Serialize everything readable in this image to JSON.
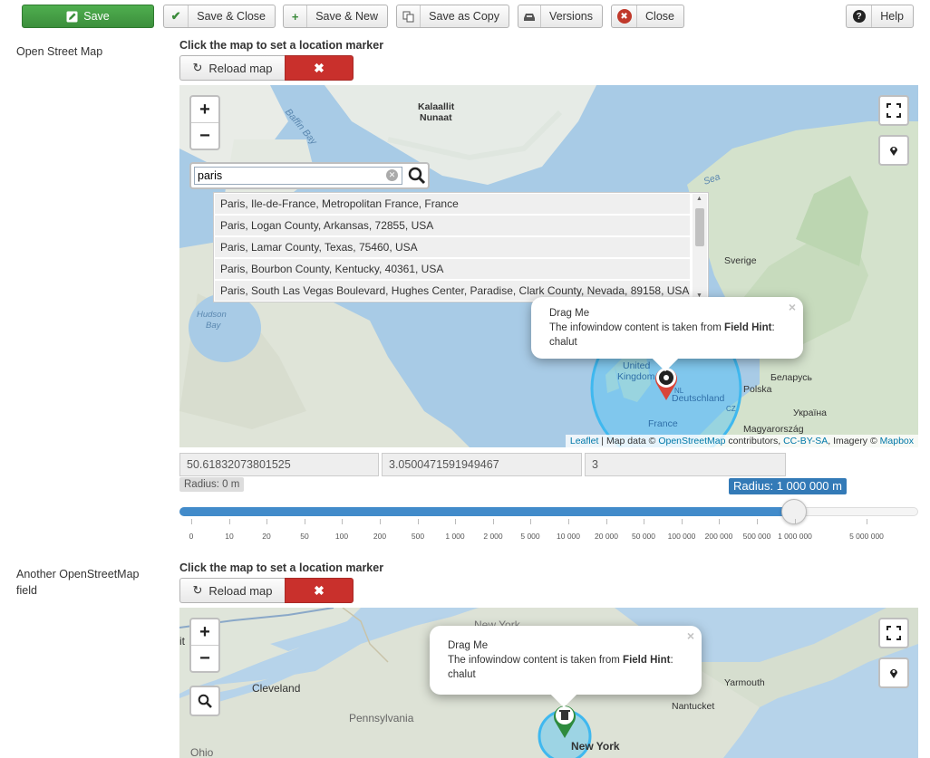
{
  "toolbar": {
    "save": "Save",
    "save_close": "Save & Close",
    "save_new": "Save & New",
    "save_copy": "Save as Copy",
    "versions": "Versions",
    "close": "Close",
    "help": "Help"
  },
  "field1": {
    "label": "Open Street Map",
    "instruction": "Click the map to set a location marker",
    "reload": "Reload map",
    "search_value": "paris",
    "results": [
      "Paris, Ile-de-France, Metropolitan France, France",
      "Paris, Logan County, Arkansas, 72855, USA",
      "Paris, Lamar County, Texas, 75460, USA",
      "Paris, Bourbon County, Kentucky, 40361, USA",
      "Paris, South Las Vegas Boulevard, Hughes Center, Paradise, Clark County, Nevada, 89158, USA"
    ],
    "popup": {
      "title": "Drag Me",
      "line_prefix": "The infowindow content is taken from ",
      "line_bold": "Field Hint",
      "line_suffix": ":",
      "value": "chalut"
    },
    "map_labels": {
      "kalaallit1": "Kalaallit",
      "kalaallit2": "Nunaat",
      "baffin": "Baffin Bay",
      "hudson1": "Hudson",
      "hudson2": "Bay",
      "sea": "Sea",
      "sverige": "Sverige",
      "uk1": "United",
      "uk2": "Kingdom",
      "nl": "NL",
      "deutschland": "Deutschland",
      "polska": "Polska",
      "belarus": "Беларусь",
      "cz": "CZ",
      "ukraina": "Україна",
      "france": "France",
      "magyar": "Magyarország"
    },
    "attribution": {
      "leaflet": "Leaflet",
      "sep": " | Map data © ",
      "osm": "OpenStreetMap",
      "contrib": " contributors, ",
      "ccbysa": "CC-BY-SA",
      "imagery": ", Imagery © ",
      "mapbox": "Mapbox"
    },
    "lat": "50.61832073801525",
    "lng": "3.0500471591949467",
    "zoom": "3",
    "radius_small": "Radius: 0 m",
    "radius_big": "Radius: 1 000 000 m",
    "slider_fraction": 0.832,
    "ticks": [
      "0",
      "10",
      "20",
      "50",
      "100",
      "200",
      "500",
      "1 000",
      "2 000",
      "5 000",
      "10 000",
      "20 000",
      "50 000",
      "100 000",
      "200 000",
      "500 000",
      "1 000 000",
      "5 000 000"
    ]
  },
  "field2": {
    "label_line1": "Another OpenStreetMap",
    "label_line2": "field",
    "instruction": "Click the map to set a location marker",
    "reload": "Reload map",
    "popup": {
      "title": "Drag Me",
      "line_prefix": "The infowindow content is taken from ",
      "line_bold": "Field Hint",
      "line_suffix": ":",
      "value": "chalut"
    },
    "map_labels": {
      "it": "it",
      "cleveland": "Cleveland",
      "pennsylvania": "Pennsylvania",
      "ohio": "Ohio",
      "newyork_state": "New York",
      "yarmouth": "Yarmouth",
      "nantucket": "Nantucket",
      "newyork_city": "New York"
    }
  },
  "colors": {
    "save_green": "#47a447",
    "danger_red": "#c9302c",
    "slider_blue": "#428bca",
    "badge_blue": "#337ab7",
    "marker_red": "#d9453a",
    "marker_green": "#2e8b3e",
    "circle_blue": "#4fc3f7"
  }
}
